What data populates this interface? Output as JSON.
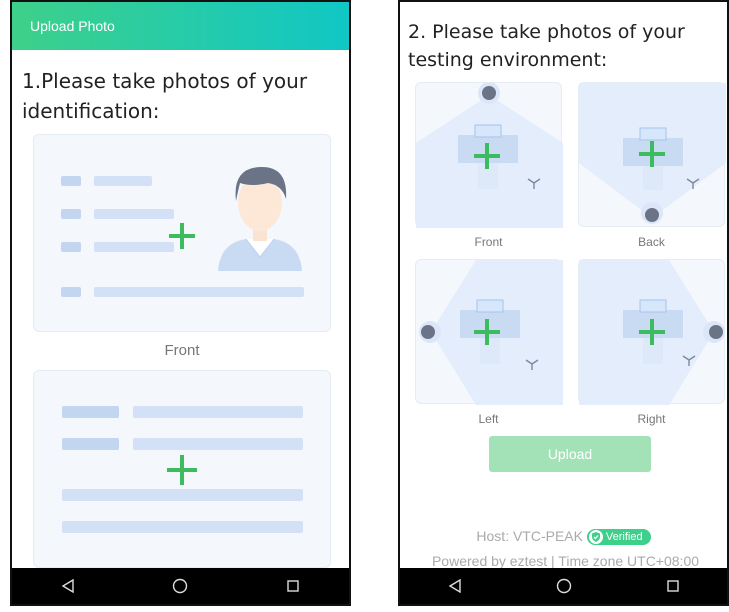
{
  "phone1": {
    "header_title": "Upload Photo",
    "section_title": "1.Please take photos of your identification:",
    "front_label": "Front"
  },
  "phone2": {
    "section_title": "2. Please take photos of your testing environment:",
    "labels": {
      "front": "Front",
      "back": "Back",
      "left": "Left",
      "right": "Right"
    },
    "upload_label": "Upload",
    "host_text": "Host: VTC-PEAK",
    "verified_label": "Verified",
    "powered_text": "Powered by eztest | Time zone UTC+08:00"
  },
  "colors": {
    "header_start": "#3ed08a",
    "header_end": "#10c7c5",
    "plus": "#3dbb5f",
    "upload_btn": "#a3e2b6",
    "verified": "#3ed08a"
  },
  "icons": [
    "plus-icon",
    "avatar-illustration",
    "back-triangle-icon",
    "home-circle-icon",
    "recent-square-icon",
    "shield-check-icon"
  ]
}
